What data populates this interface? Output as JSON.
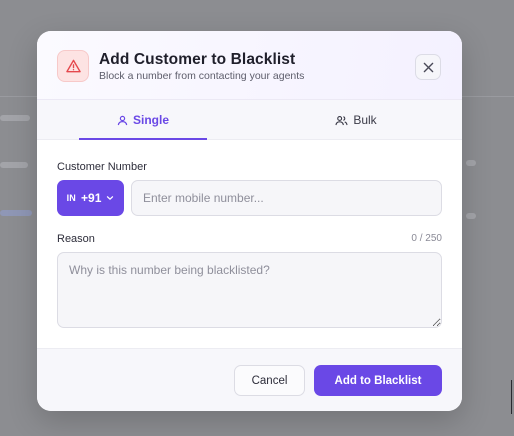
{
  "modal": {
    "title": "Add Customer to Blacklist",
    "subtitle": "Block a number from contacting your agents"
  },
  "tabs": [
    {
      "label": "Single",
      "icon": "user-icon",
      "active": true
    },
    {
      "label": "Bulk",
      "icon": "users-icon",
      "active": false
    }
  ],
  "form": {
    "customer_number_label": "Customer Number",
    "country_code": "IN",
    "dial_code": "+91",
    "phone_placeholder": "Enter mobile number...",
    "phone_value": "",
    "reason_label": "Reason",
    "reason_counter": "0 / 250",
    "reason_placeholder": "Why is this number being blacklisted?",
    "reason_value": ""
  },
  "footer": {
    "cancel_label": "Cancel",
    "submit_label": "Add to Blacklist"
  },
  "colors": {
    "accent": "#6a48e6",
    "warning": "#e5484d",
    "overlay": "#8c8d91"
  },
  "icons": [
    "warning-triangle-icon",
    "close-icon",
    "user-icon",
    "users-icon",
    "chevron-down-icon"
  ]
}
